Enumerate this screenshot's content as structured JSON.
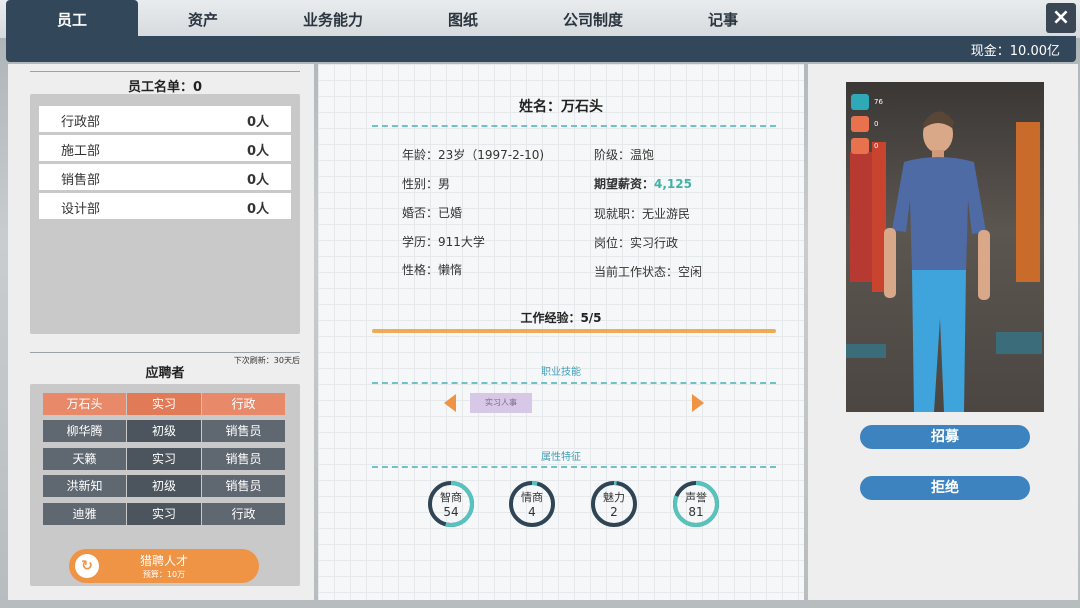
{
  "tabs": [
    {
      "label": "员工",
      "active": true
    },
    {
      "label": "资产"
    },
    {
      "label": "业务能力"
    },
    {
      "label": "图纸"
    },
    {
      "label": "公司制度"
    },
    {
      "label": "记事"
    }
  ],
  "close_icon": "×",
  "cash": "现金：10.00亿",
  "roster": {
    "title": "员工名单：0",
    "departments": [
      {
        "name": "行政部",
        "count": "0人"
      },
      {
        "name": "施工部",
        "count": "0人"
      },
      {
        "name": "销售部",
        "count": "0人"
      },
      {
        "name": "设计部",
        "count": "0人"
      }
    ]
  },
  "applicants": {
    "title": "应聘者",
    "refresh_note": "下次刷新：30天后",
    "rows": [
      {
        "name": "万石头",
        "level": "实习",
        "role": "行政",
        "selected": true
      },
      {
        "name": "柳华腾",
        "level": "初级",
        "role": "销售员"
      },
      {
        "name": "天籁",
        "level": "实习",
        "role": "销售员"
      },
      {
        "name": "洪新知",
        "level": "初级",
        "role": "销售员"
      },
      {
        "name": "迪雅",
        "level": "实习",
        "role": "行政"
      }
    ],
    "hunt_button": {
      "label": "猎聘人才",
      "sub": "预算：10万",
      "icon": "refresh-icon"
    }
  },
  "profile": {
    "name_line": "姓名：万石头",
    "left_fields": [
      "年龄：23岁（1997-2-10)",
      "性别：男",
      "婚否：已婚",
      "学历：911大学",
      "性格：懒惰"
    ],
    "right_fields": {
      "class": "阶级：温饱",
      "salary_label": "期望薪资：",
      "salary_value": "4,125",
      "current_job": "现就职：无业游民",
      "position": "岗位：实习行政",
      "work_status": "当前工作状态：空闲"
    },
    "experience": "工作经验：5/5",
    "skills_title": "职业技能",
    "skill_tag": "实习人事",
    "traits_title": "属性特征",
    "attributes": [
      {
        "label": "智商",
        "value": "54",
        "pct": 0.54
      },
      {
        "label": "情商",
        "value": "4",
        "pct": 0.04
      },
      {
        "label": "魅力",
        "value": "2",
        "pct": 0.02
      },
      {
        "label": "声誉",
        "value": "81",
        "pct": 0.81
      }
    ]
  },
  "portrait_stats": [
    {
      "icon": "heartbeat-icon",
      "value": "76"
    },
    {
      "icon": "smile-icon",
      "value": "0"
    },
    {
      "icon": "strength-icon",
      "value": "0"
    }
  ],
  "buttons": {
    "recruit": "招募",
    "reject": "拒绝"
  },
  "colors": {
    "dark": "#33475a",
    "accent": "#ef9345",
    "teal": "#41b2a8",
    "blue": "#3d83c0",
    "selected_row": "#e88a6a"
  }
}
